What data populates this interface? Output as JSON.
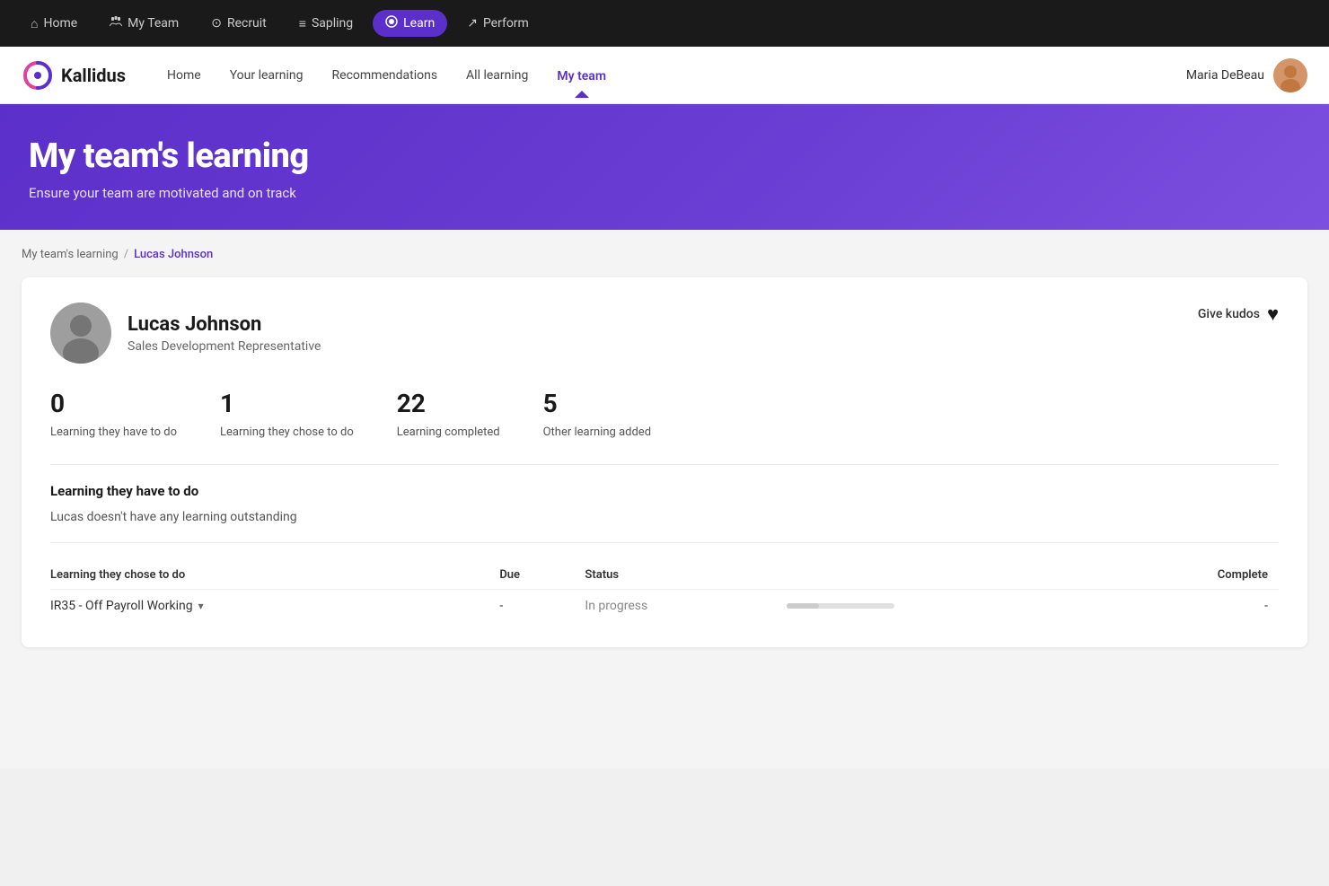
{
  "topNav": {
    "items": [
      {
        "id": "home",
        "label": "Home",
        "icon": "⌂",
        "active": false
      },
      {
        "id": "my-team",
        "label": "My Team",
        "icon": "↑↓",
        "active": false
      },
      {
        "id": "recruit",
        "label": "Recruit",
        "icon": "⊙",
        "active": false
      },
      {
        "id": "sapling",
        "label": "Sapling",
        "icon": "≡",
        "active": false
      },
      {
        "id": "learn",
        "label": "Learn",
        "icon": "●",
        "active": true
      },
      {
        "id": "perform",
        "label": "Perform",
        "icon": "↗",
        "active": false
      }
    ]
  },
  "secondaryNav": {
    "logoText": "Kallidus",
    "links": [
      {
        "id": "home",
        "label": "Home",
        "active": false
      },
      {
        "id": "your-learning",
        "label": "Your learning",
        "active": false
      },
      {
        "id": "recommendations",
        "label": "Recommendations",
        "active": false
      },
      {
        "id": "all-learning",
        "label": "All learning",
        "active": false
      },
      {
        "id": "my-team",
        "label": "My team",
        "active": true
      }
    ],
    "userName": "Maria DeBeau",
    "userAvatarEmoji": "👩"
  },
  "hero": {
    "title": "My team's learning",
    "subtitle": "Ensure your team are motivated and on track"
  },
  "breadcrumb": {
    "parent": "My team's learning",
    "current": "Lucas Johnson"
  },
  "profile": {
    "name": "Lucas Johnson",
    "role": "Sales Development Representative",
    "avatarEmoji": "👨",
    "kudosLabel": "Give kudos",
    "stats": [
      {
        "number": "0",
        "label": "Learning they have to do"
      },
      {
        "number": "1",
        "label": "Learning they chose to do"
      },
      {
        "number": "22",
        "label": "Learning completed"
      },
      {
        "number": "5",
        "label": "Other learning added"
      }
    ],
    "sectionHaveToDo": {
      "title": "Learning they have to do",
      "emptyMessage": "Lucas doesn't have any learning outstanding"
    },
    "sectionChoseToDo": {
      "title": "Learning they chose to do",
      "columns": {
        "name": "Learning they chose to do",
        "due": "Due",
        "status": "Status",
        "complete": "Complete"
      },
      "items": [
        {
          "name": "IR35 - Off Payroll Working",
          "due": "-",
          "status": "In progress",
          "complete": "-",
          "progress": 30
        }
      ]
    }
  }
}
